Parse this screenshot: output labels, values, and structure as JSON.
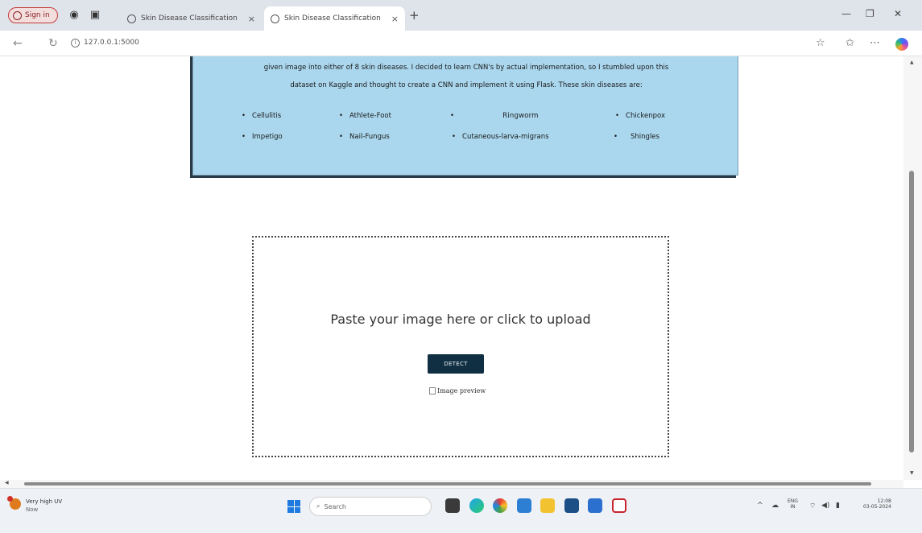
{
  "browser": {
    "profile_label": "Sign in",
    "tabs": [
      {
        "title": "Skin Disease Classification",
        "active": false
      },
      {
        "title": "Skin Disease Classification",
        "active": true
      }
    ],
    "new_tab_glyph": "+",
    "url": "127.0.0.1:5000"
  },
  "page": {
    "intro_line1": "given image into either of 8 skin diseases. I decided to learn CNN's by actual implementation, so I stumbled upon this",
    "intro_line2": "dataset on Kaggle and thought to create a CNN and implement it using Flask. These skin diseases are:",
    "diseases": [
      "Cellulitis",
      "Athlete-Foot",
      "Ringworm",
      "Chickenpox",
      "Impetigo",
      "Nail-Fungus",
      "Cutaneous-larva-migrans",
      "Shingles"
    ],
    "upload_prompt": "Paste your image here or click to upload",
    "detect_label": "DETECT",
    "preview_alt": "Image preview"
  },
  "taskbar": {
    "weather_title": "Very high UV",
    "weather_sub": "Now",
    "search_placeholder": "Search",
    "tray_lang": "ENG",
    "tray_region": "IN",
    "clock_time": "12:08",
    "clock_date": "03-05-2024"
  },
  "colors": {
    "info_box_bg": "#aad7ee",
    "detect_bg": "#102f42",
    "windows_blue": "#1f7ae0"
  }
}
